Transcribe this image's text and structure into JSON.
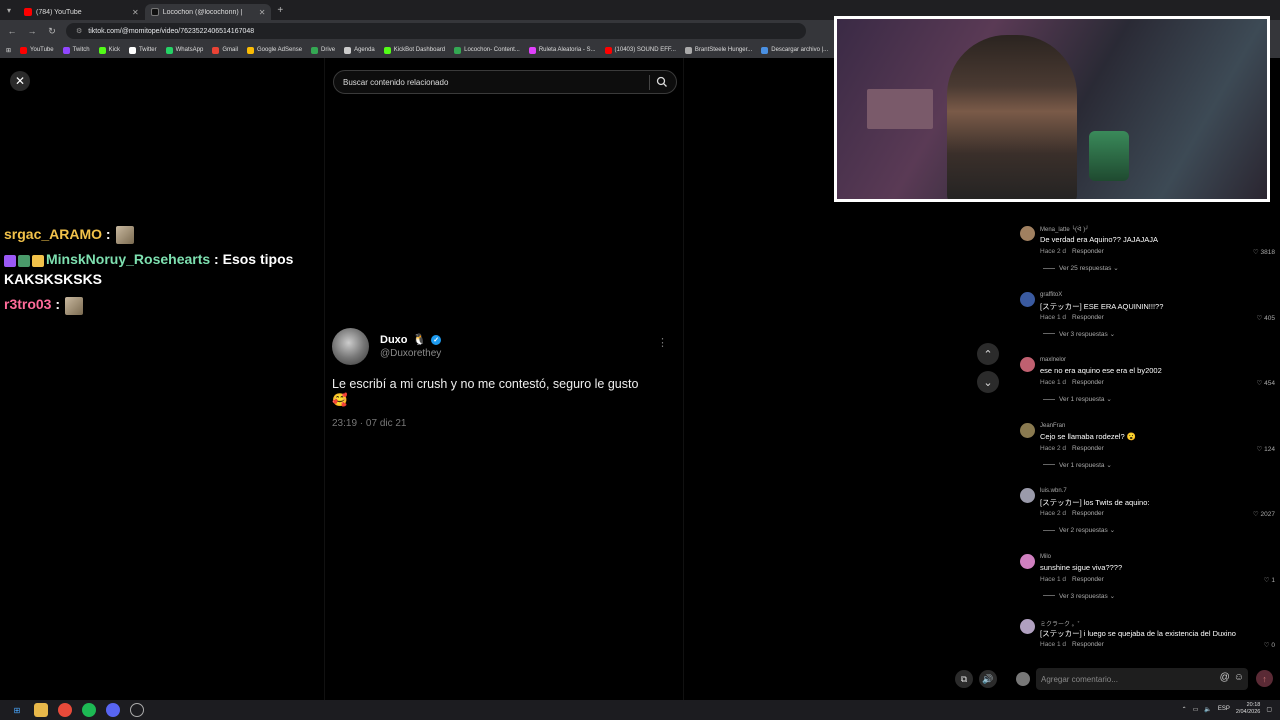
{
  "browser": {
    "tabs": [
      {
        "label": "(784) YouTube",
        "color": "#ff0000"
      },
      {
        "label": "Locochon (@locochonn) |",
        "color": "#111111"
      }
    ],
    "url": "tiktok.com/@momitope/video/7623522406514167048",
    "bookmarks": [
      {
        "label": "YouTube",
        "color": "#ff0000"
      },
      {
        "label": "Twitch",
        "color": "#9146ff"
      },
      {
        "label": "Kick",
        "color": "#53fc18"
      },
      {
        "label": "Twitter",
        "color": "#ffffff"
      },
      {
        "label": "WhatsApp",
        "color": "#25d366"
      },
      {
        "label": "Gmail",
        "color": "#ea4335"
      },
      {
        "label": "Google AdSense",
        "color": "#fbbc04"
      },
      {
        "label": "Drive",
        "color": "#34a853"
      },
      {
        "label": "Agenda",
        "color": "#cccccc"
      },
      {
        "label": "KickBot Dashboard",
        "color": "#53fc18"
      },
      {
        "label": "Locochon- Content...",
        "color": "#34a853"
      },
      {
        "label": "Ruleta Aleatoria - S...",
        "color": "#e040fb"
      },
      {
        "label": "(10403) SOUND EFF...",
        "color": "#ff0000"
      },
      {
        "label": "BrantSteele Hunger...",
        "color": "#aaaaaa"
      },
      {
        "label": "Descargar archivo |...",
        "color": "#4a90e2"
      }
    ]
  },
  "video": {
    "search_placeholder": "Buscar contenido relacionado"
  },
  "tweet": {
    "name": "Duxo",
    "emoji": "🐧",
    "handle": "@Duxorethey",
    "text": "Le escribí a mi crush y no me contestó, seguro le gusto",
    "text_emoji": "🥰",
    "time": "23:19 · 07 dic 21"
  },
  "chat": [
    {
      "user": "srgac_ARAMO",
      "user_color": "#f2c24a",
      "sep": " :",
      "message": "",
      "has_emote": true,
      "badges": []
    },
    {
      "user": "MinskNoruy_Rosehearts",
      "user_color": "#7ee0b0",
      "sep": " :",
      "message": " Esos tipos KAKSKSKSKS",
      "has_emote": false,
      "badges": [
        "#9b59f6",
        "#4a9a6a",
        "#f2c24a"
      ]
    },
    {
      "user": "r3tro03",
      "user_color": "#ff6b9a",
      "sep": " :",
      "message": "",
      "has_emote": true,
      "badges": []
    }
  ],
  "comments": [
    {
      "user": "Mena_latte ╰(ᐛ )╯",
      "text": "De verdad era Aquino?? JAJAJAJA",
      "time": "Hace 2 d",
      "reply": "Responder",
      "likes": "3818",
      "replies": "Ver 25 respuestas",
      "avatar": "#a08060"
    },
    {
      "user": "graffitoX",
      "text": "[ステッカー] ESE ERA AQUININ!!!??",
      "time": "Hace 1 d",
      "reply": "Responder",
      "likes": "405",
      "replies": "Ver 3 respuestas",
      "avatar": "#3a5aa0"
    },
    {
      "user": "maxlnelor",
      "text": "ese no era aquino ese era el by2002",
      "time": "Hace 1 d",
      "reply": "Responder",
      "likes": "454",
      "replies": "Ver 1 respuesta",
      "avatar": "#c06070"
    },
    {
      "user": "JeanFran",
      "text": "Cejo se llamaba rodezel? 😮",
      "time": "Hace 2 d",
      "reply": "Responder",
      "likes": "124",
      "replies": "Ver 1 respuesta",
      "avatar": "#8a7a50"
    },
    {
      "user": "luis.wbn.7",
      "text": "[ステッカー] los Twits de aquino:",
      "time": "Hace 2 d",
      "reply": "Responder",
      "likes": "2027",
      "replies": "Ver 2 respuestas",
      "avatar": "#9a9aaa"
    },
    {
      "user": "Milo",
      "text": "sunshine sigue viva????",
      "time": "Hace 1 d",
      "reply": "Responder",
      "likes": "1",
      "replies": "Ver 3 respuestas",
      "avatar": "#d080c0"
    },
    {
      "user": "ミクラーク 。˚",
      "text": "[ステッカー] i luego se quejaba de la existencia del Duxino",
      "time": "Hace 1 d",
      "reply": "Responder",
      "likes": "0",
      "replies": "",
      "avatar": "#b0a0c0"
    }
  ],
  "comment_input": {
    "placeholder": "Agregar comentario..."
  },
  "taskbar": {
    "lang": "ESP",
    "time": "20:18",
    "date": "2/04/2026"
  }
}
